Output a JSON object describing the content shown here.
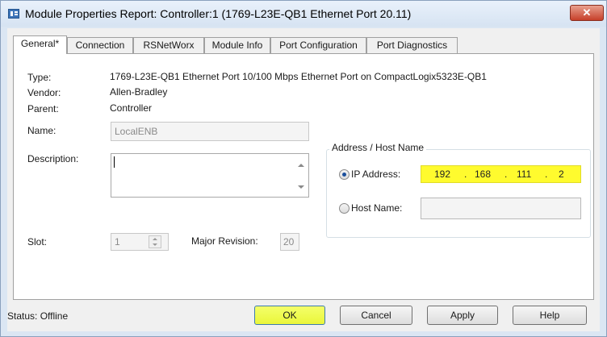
{
  "window": {
    "title": "Module Properties Report: Controller:1 (1769-L23E-QB1 Ethernet Port 20.11)",
    "close_label": "✕"
  },
  "tabs": [
    {
      "label": "General*",
      "active": true
    },
    {
      "label": "Connection",
      "active": false
    },
    {
      "label": "RSNetWorx",
      "active": false
    },
    {
      "label": "Module Info",
      "active": false
    },
    {
      "label": "Port Configuration",
      "active": false
    },
    {
      "label": "Port Diagnostics",
      "active": false
    }
  ],
  "general": {
    "type_label": "Type:",
    "type_value": "1769-L23E-QB1 Ethernet Port 10/100 Mbps Ethernet Port on CompactLogix5323E-QB1",
    "vendor_label": "Vendor:",
    "vendor_value": "Allen-Bradley",
    "parent_label": "Parent:",
    "parent_value": "Controller",
    "name_label": "Name:",
    "name_value": "LocalENB",
    "description_label": "Description:",
    "description_value": "",
    "slot_label": "Slot:",
    "slot_value": "1",
    "major_revision_label": "Major Revision:",
    "major_revision_value": "20"
  },
  "address": {
    "group_title": "Address / Host Name",
    "ip_label": "IP Address:",
    "ip_selected": true,
    "ip_octets": [
      "192",
      "168",
      "111",
      "2"
    ],
    "ip_separator": ".",
    "host_label": "Host Name:",
    "host_selected": false,
    "host_value": ""
  },
  "footer": {
    "status_text": "Status:  Offline",
    "ok_label": "OK",
    "cancel_label": "Cancel",
    "apply_label": "Apply",
    "help_label": "Help"
  },
  "colors": {
    "highlight": "#fffb2e",
    "title_bg": "#dbe6f3",
    "close_red": "#c6402a"
  }
}
